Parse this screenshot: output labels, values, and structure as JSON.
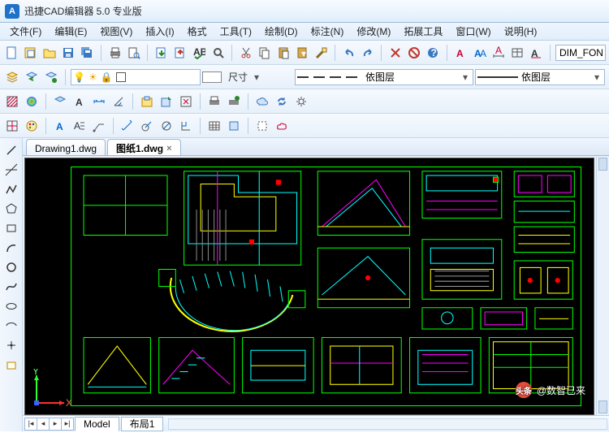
{
  "app": {
    "logo_letter": "A",
    "title": "迅捷CAD编辑器 5.0 专业版"
  },
  "menus": [
    {
      "label": "文件(F)"
    },
    {
      "label": "编辑(E)"
    },
    {
      "label": "视图(V)"
    },
    {
      "label": "插入(I)"
    },
    {
      "label": "格式"
    },
    {
      "label": "工具(T)"
    },
    {
      "label": "绘制(D)"
    },
    {
      "label": "标注(N)"
    },
    {
      "label": "修改(M)"
    },
    {
      "label": "拓展工具"
    },
    {
      "label": "窗口(W)"
    },
    {
      "label": "说明(H)"
    }
  ],
  "row2": {
    "dim_label": "尺寸",
    "layer1": "依图层",
    "layer2": "依图层"
  },
  "dim_field": "DIM_FON",
  "tabs": [
    {
      "label": "Drawing1.dwg",
      "active": false,
      "closable": false
    },
    {
      "label": "图纸1.dwg",
      "active": true,
      "closable": true
    }
  ],
  "layout": {
    "model": "Model",
    "sheet": "布局1"
  },
  "watermark": {
    "prefix": "头条",
    "text": "@数智已来"
  },
  "axis": {
    "x": "X",
    "y": "Y"
  }
}
